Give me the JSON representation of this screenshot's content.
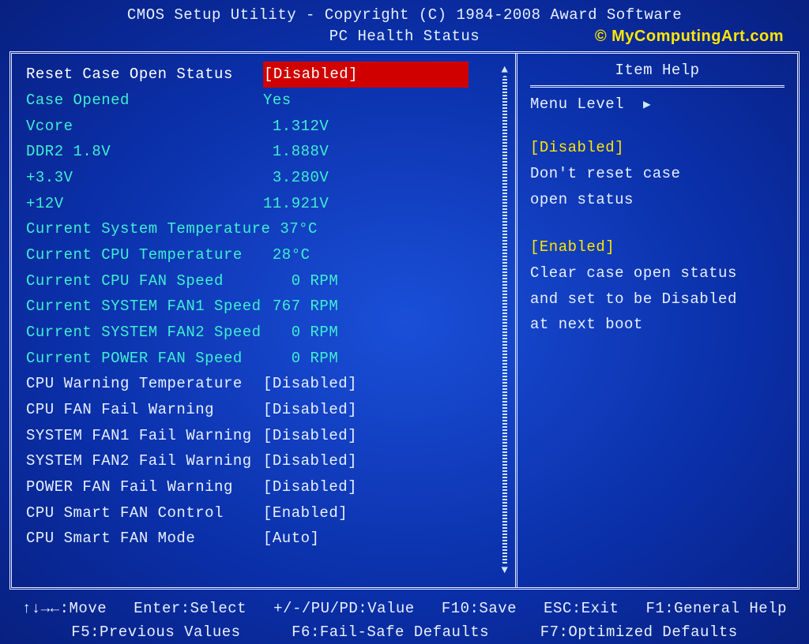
{
  "header": {
    "title": "CMOS Setup Utility - Copyright (C) 1984-2008 Award Software",
    "subtitle": "PC Health Status",
    "watermark": "© MyComputingArt.com"
  },
  "rows": [
    {
      "label": "Reset Case Open Status",
      "value": "[Disabled]",
      "kind": "editable",
      "selected": true
    },
    {
      "label": "Case Opened",
      "value": "Yes",
      "kind": "readonly"
    },
    {
      "label": "Vcore",
      "value": " 1.312V",
      "kind": "readonly"
    },
    {
      "label": "DDR2 1.8V",
      "value": " 1.888V",
      "kind": "readonly"
    },
    {
      "label": "+3.3V",
      "value": " 3.280V",
      "kind": "readonly"
    },
    {
      "label": "+12V",
      "value": "11.921V",
      "kind": "readonly"
    },
    {
      "label": "Current System Temperature",
      "value": " 37°C",
      "kind": "readonly"
    },
    {
      "label": "Current CPU Temperature",
      "value": " 28°C",
      "kind": "readonly"
    },
    {
      "label": "Current CPU FAN Speed",
      "value": "   0 RPM",
      "kind": "readonly"
    },
    {
      "label": "Current SYSTEM FAN1 Speed",
      "value": " 767 RPM",
      "kind": "readonly"
    },
    {
      "label": "Current SYSTEM FAN2 Speed",
      "value": "   0 RPM",
      "kind": "readonly"
    },
    {
      "label": "Current POWER FAN Speed",
      "value": "   0 RPM",
      "kind": "readonly"
    },
    {
      "label": "CPU Warning Temperature",
      "value": "[Disabled]",
      "kind": "editable"
    },
    {
      "label": "CPU FAN Fail Warning",
      "value": "[Disabled]",
      "kind": "editable"
    },
    {
      "label": "SYSTEM FAN1 Fail Warning",
      "value": "[Disabled]",
      "kind": "editable"
    },
    {
      "label": "SYSTEM FAN2 Fail Warning",
      "value": "[Disabled]",
      "kind": "editable"
    },
    {
      "label": "POWER FAN Fail Warning",
      "value": "[Disabled]",
      "kind": "editable"
    },
    {
      "label": "CPU Smart FAN Control",
      "value": "[Enabled]",
      "kind": "editable"
    },
    {
      "label": "CPU Smart FAN Mode",
      "value": "[Auto]",
      "kind": "editable"
    }
  ],
  "help": {
    "title": "Item Help",
    "menu_level_label": "Menu Level",
    "blocks": [
      {
        "heading": "[Disabled]",
        "lines": [
          "Don't reset case",
          "open status"
        ]
      },
      {
        "heading": "[Enabled]",
        "lines": [
          "Clear case open status",
          "and set to be Disabled",
          "at next boot"
        ]
      }
    ]
  },
  "footer": {
    "row1": [
      "↑↓→←:Move",
      "Enter:Select",
      "+/-/PU/PD:Value",
      "F10:Save",
      "ESC:Exit",
      "F1:General Help"
    ],
    "row2": [
      "F5:Previous Values",
      "F6:Fail-Safe Defaults",
      "F7:Optimized Defaults"
    ]
  }
}
